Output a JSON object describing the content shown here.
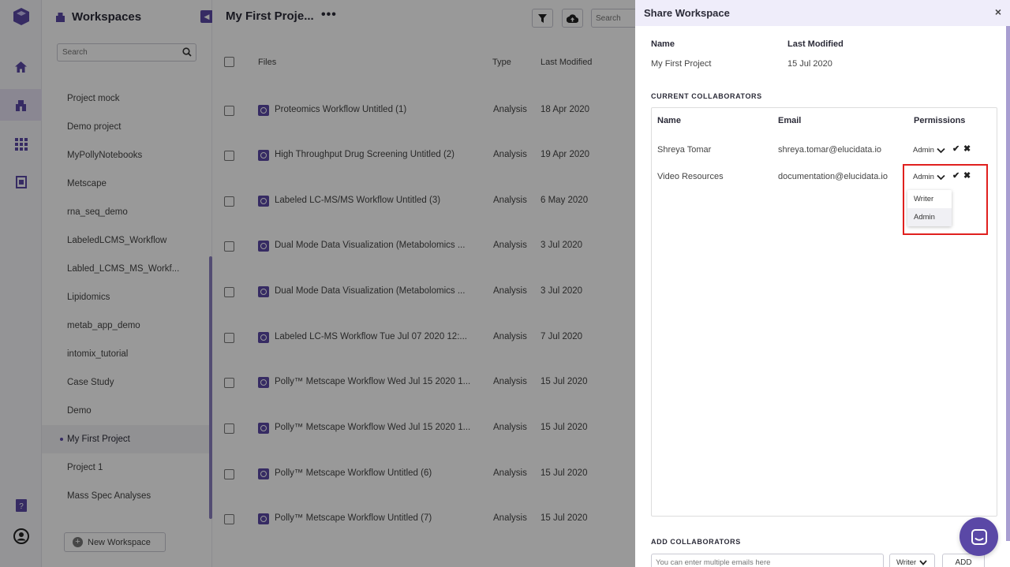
{
  "sidebar": {
    "title": "Workspaces",
    "search_placeholder": "Search",
    "items": [
      {
        "label": "Project mock"
      },
      {
        "label": "Demo project"
      },
      {
        "label": "MyPollyNotebooks"
      },
      {
        "label": "Metscape"
      },
      {
        "label": "rna_seq_demo"
      },
      {
        "label": "LabeledLCMS_Workflow"
      },
      {
        "label": "Labled_LCMS_MS_Workf..."
      },
      {
        "label": "Lipidomics"
      },
      {
        "label": "metab_app_demo"
      },
      {
        "label": "intomix_tutorial"
      },
      {
        "label": "Case Study"
      },
      {
        "label": "Demo"
      },
      {
        "label": "My First Project"
      },
      {
        "label": "Project 1"
      },
      {
        "label": "Mass Spec Analyses"
      }
    ],
    "new_workspace_label": "New Workspace"
  },
  "main": {
    "project_title": "My First Proje...",
    "more_label": "•••",
    "search_placeholder": "Search",
    "columns": {
      "files": "Files",
      "type": "Type",
      "modified": "Last Modified"
    },
    "rows": [
      {
        "name": "Proteomics Workflow Untitled (1)",
        "type": "Analysis",
        "date": "18 Apr 2020"
      },
      {
        "name": "High Throughput Drug Screening Untitled (2)",
        "type": "Analysis",
        "date": "19 Apr 2020"
      },
      {
        "name": "Labeled LC-MS/MS Workflow Untitled (3)",
        "type": "Analysis",
        "date": "6 May 2020"
      },
      {
        "name": "Dual Mode Data Visualization (Metabolomics ...",
        "type": "Analysis",
        "date": "3 Jul 2020"
      },
      {
        "name": "Dual Mode Data Visualization (Metabolomics ...",
        "type": "Analysis",
        "date": "3 Jul 2020"
      },
      {
        "name": "Labeled LC-MS Workflow Tue Jul 07 2020 12:...",
        "type": "Analysis",
        "date": "7 Jul 2020"
      },
      {
        "name": "Polly™ Metscape Workflow Wed Jul 15 2020 1...",
        "type": "Analysis",
        "date": "15 Jul 2020"
      },
      {
        "name": "Polly™ Metscape Workflow Wed Jul 15 2020 1...",
        "type": "Analysis",
        "date": "15 Jul 2020"
      },
      {
        "name": "Polly™ Metscape Workflow Untitled (6)",
        "type": "Analysis",
        "date": "15 Jul 2020"
      },
      {
        "name": "Polly™ Metscape Workflow Untitled (7)",
        "type": "Analysis",
        "date": "15 Jul 2020"
      }
    ]
  },
  "share": {
    "title": "Share Workspace",
    "close_label": "×",
    "name_label": "Name",
    "modified_label": "Last Modified",
    "name_value": "My First Project",
    "modified_value": "15 Jul 2020",
    "current_heading": "CURRENT COLLABORATORS",
    "col_name": "Name",
    "col_email": "Email",
    "col_permissions": "Permissions",
    "collaborators": [
      {
        "name": "Shreya Tomar",
        "email": "shreya.tomar@elucidata.io",
        "permission": "Admin"
      },
      {
        "name": "Video Resources",
        "email": "documentation@elucidata.io",
        "permission": "Admin"
      }
    ],
    "dropdown_options": [
      "Writer",
      "Admin"
    ],
    "add_heading": "ADD COLLABORATORS",
    "email_placeholder": "You can enter multiple emails here",
    "new_permission": "Writer",
    "add_label": "ADD",
    "confirm_glyph": "✔",
    "cancel_glyph": "✖"
  },
  "colors": {
    "accent": "#5a48a6",
    "highlight": "#e0201e",
    "panel_header": "#efedfa"
  }
}
